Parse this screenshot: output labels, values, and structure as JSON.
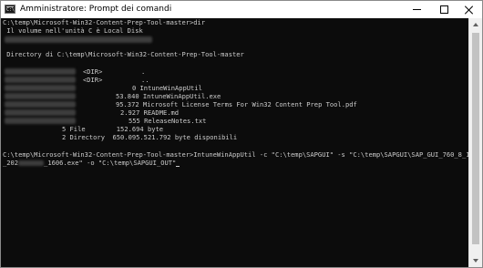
{
  "window": {
    "title": "Amministratore: Prompt dei comandi",
    "icon_label": "C:\\",
    "controls": [
      "minimize-icon",
      "maximize-icon",
      "close-icon"
    ]
  },
  "console": {
    "lines": {
      "l1": "C:\\temp\\Microsoft-Win32-Content-Prep-Tool-master>dir",
      "l2": " Il volume nell'unità C è Local Disk",
      "l4": " Directory di C:\\temp\\Microsoft-Win32-Content-Prep-Tool-master",
      "d1": "<DIR>          .",
      "d2": "<DIR>          ..",
      "f1": "0 IntuneWinAppUtil",
      "f2": "53.840 IntuneWinAppUtil.exe",
      "f3": "95.372 Microsoft License Terms For Win32 Content Prep Tool.pdf",
      "f4": "2.927 README.md",
      "f5": "555 ReleaseNotes.txt",
      "s1": "5 File        152.694 byte",
      "s2": "2 Directory  650.095.521.792 byte disponibili",
      "c1": "C:\\temp\\Microsoft-Win32-Content-Prep-Tool-master>IntuneWinAppUtil -c \"C:\\temp\\SAPGUI\" -s \"C:\\temp\\SAPGUI\\SAP_GUI_760_8_1",
      "c2a": "_202",
      "c2b": "_1606.exe\" -o \"C:\\temp\\SAPGUI_OUT\""
    },
    "colors": {
      "background": "#0c0c0c",
      "text": "#cccccc"
    }
  },
  "scrollbar": {
    "up": "chevron-up-icon",
    "down": "chevron-down-icon"
  }
}
